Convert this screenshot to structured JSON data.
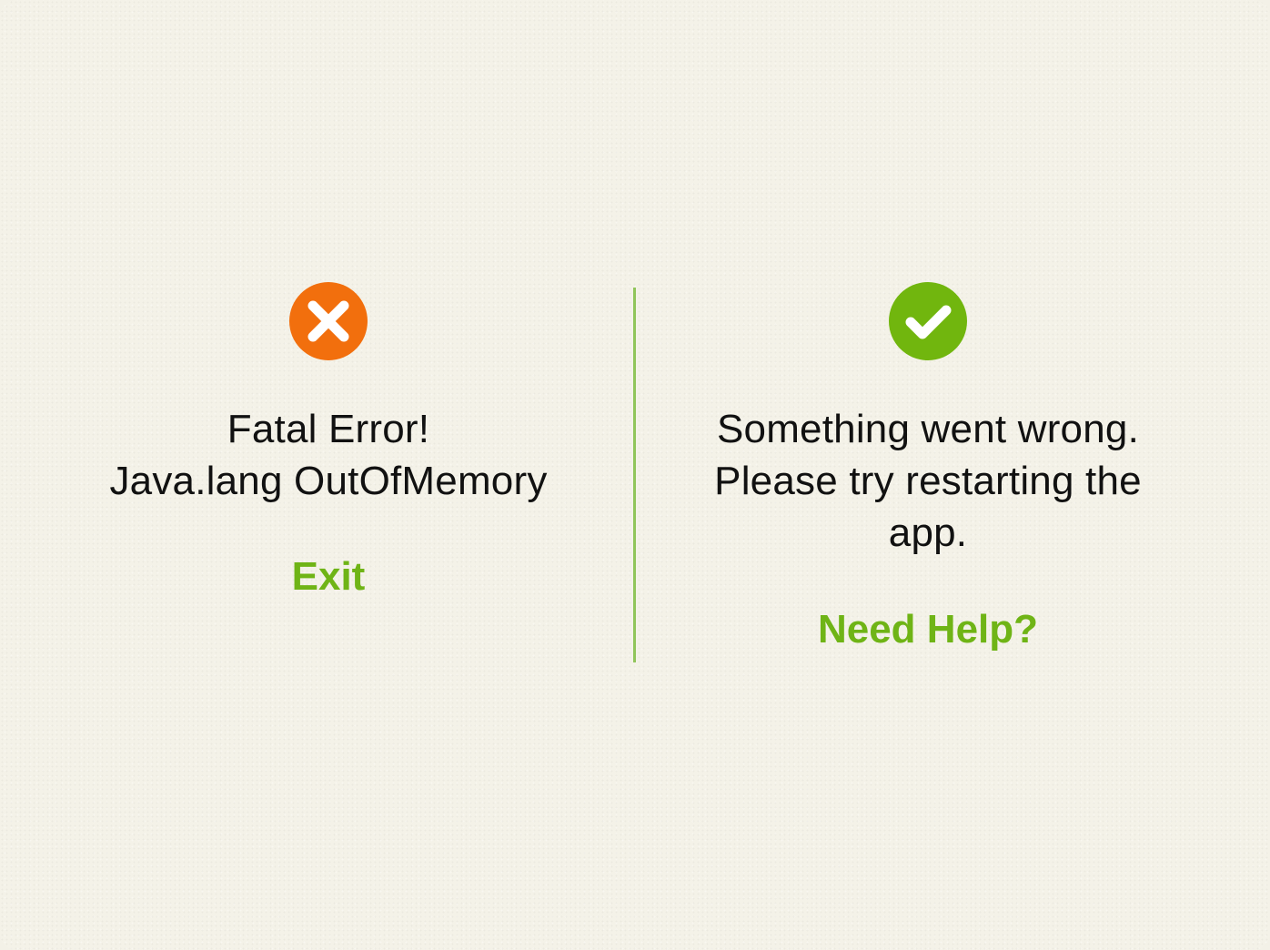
{
  "colors": {
    "background": "#f4f2e8",
    "divider": "#90c55a",
    "error_icon": "#f26f0d",
    "success_icon": "#71b60e",
    "action_text": "#6fb416",
    "message_text": "#111111"
  },
  "left_panel": {
    "icon": "close-circle-icon",
    "message_lines": [
      "Fatal Error!",
      "Java.lang OutOfMemory"
    ],
    "action_label": "Exit"
  },
  "right_panel": {
    "icon": "check-circle-icon",
    "message_lines": [
      "Something went wrong.",
      "Please try restarting the",
      "app."
    ],
    "action_label": "Need Help?"
  }
}
